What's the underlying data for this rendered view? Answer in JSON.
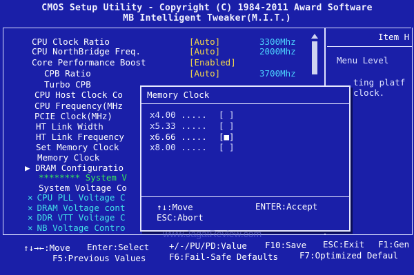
{
  "header": {
    "title_line1": "CMOS Setup Utility - Copyright (C) 1984-2011 Award Software",
    "title_line2": "MB Intelligent Tweaker(M.I.T.)"
  },
  "settings": [
    {
      "label": "CPU Clock Ratio",
      "value": "[Auto]",
      "freq": "3300Mhz"
    },
    {
      "label": "CPU NorthBridge Freq.",
      "value": "[Auto]",
      "freq": "2000Mhz"
    },
    {
      "label": "Core Performance Boost",
      "value": "[Enabled]",
      "freq": ""
    },
    {
      "label": "CPB Ratio",
      "value": "[Auto]",
      "freq": "3700Mhz"
    },
    {
      "label": "Turbo CPB",
      "value": "",
      "freq": ""
    },
    {
      "label": "CPU Host Clock Co",
      "value": "",
      "freq": ""
    },
    {
      "label": "CPU Frequency(MHz",
      "value": "",
      "freq": ""
    },
    {
      "label": "PCIE Clock(MHz)",
      "value": "",
      "freq": ""
    },
    {
      "label": "HT Link Width",
      "value": "",
      "freq": ""
    },
    {
      "label": "HT Link Frequency",
      "value": "",
      "freq": ""
    },
    {
      "label": "Set Memory Clock",
      "value": "",
      "freq": ""
    },
    {
      "label": "Memory Clock",
      "value": "",
      "freq": ""
    },
    {
      "label": "DRAM Configuratio",
      "value": "",
      "freq": ""
    },
    {
      "label": "******** System V",
      "value": "",
      "freq": ""
    },
    {
      "label": "System Voltage Co",
      "value": "",
      "freq": ""
    },
    {
      "label": "CPU PLL Voltage C",
      "value": "",
      "freq": ""
    },
    {
      "label": "DRAM Voltage cont",
      "value": "",
      "freq": ""
    },
    {
      "label": "DDR VTT Voltage C",
      "value": "",
      "freq": ""
    },
    {
      "label": "NB Voltage Contro",
      "value": "",
      "freq": ""
    }
  ],
  "help": {
    "title": "Item H",
    "menu_level": "Menu Level",
    "text_line1": "ting platf",
    "text_line2": "clock."
  },
  "popup": {
    "title": "Memory Clock",
    "options": [
      {
        "label": "x4.00 .....",
        "box": "[ ]"
      },
      {
        "label": "x5.33 .....",
        "box": "[ ]"
      },
      {
        "label": "x6.66 .....",
        "box": "[■]"
      },
      {
        "label": "x8.00 .....",
        "box": "[ ]"
      }
    ],
    "move_hint": "↑↓:Move",
    "enter_hint": "ENTER:Accept",
    "esc_hint": "ESC:Abort"
  },
  "footer": {
    "row1": [
      "↑↓→←:Move",
      "Enter:Select",
      "+/-/PU/PD:Value",
      "F10:Save",
      "ESC:Exit",
      "F1:Gen"
    ],
    "row2": [
      "F5:Previous Values",
      "F6:Fail-Safe Defaults",
      "F7:Optimized Defaul"
    ]
  },
  "watermark": "www.JagatReview.com",
  "icons": {
    "arrow": "right-triangle-icon",
    "disabled": "x-mark-icon"
  }
}
